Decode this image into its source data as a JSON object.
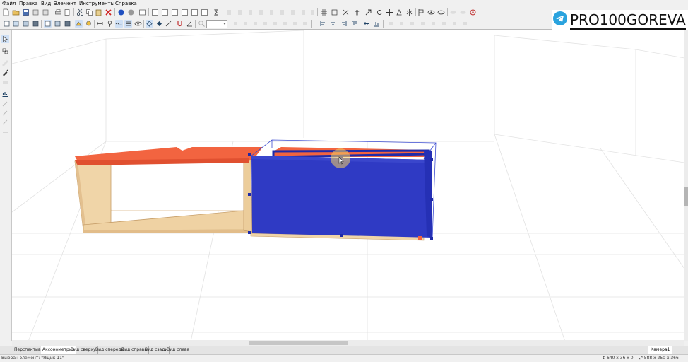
{
  "menu": [
    "Файл",
    "Правка",
    "Вид",
    "Элемент",
    "Инструменты",
    "Справка"
  ],
  "brand": {
    "text": "PRO100GOREVA",
    "icon": "telegram-icon",
    "color": "#2aa3de"
  },
  "view_tabs": [
    {
      "label": "Перспектива",
      "active": false
    },
    {
      "label": "Аксонометрия",
      "active": true
    },
    {
      "label": "Вид сверху",
      "active": false
    },
    {
      "label": "Вид спереди",
      "active": false
    },
    {
      "label": "Вид справа",
      "active": false
    },
    {
      "label": "Вид сзади",
      "active": false
    },
    {
      "label": "Вид слева",
      "active": false
    }
  ],
  "camera_tab": "Камера1",
  "status": {
    "selected": "Выбран элемент: \"Ящик 11\"",
    "size_a": "640 x 36 x 0",
    "size_b": "588 x 250 x 366"
  },
  "scene": {
    "colors": {
      "top_panel": "#f26440",
      "wood": "#f0d5a8",
      "wood_dark": "#d9b483",
      "drawer": "#2f3ac4",
      "drawer_edge": "#1f2aa8",
      "selection": "#3b4bd0"
    },
    "objects": [
      "cabinet",
      "drawer-selected"
    ]
  }
}
